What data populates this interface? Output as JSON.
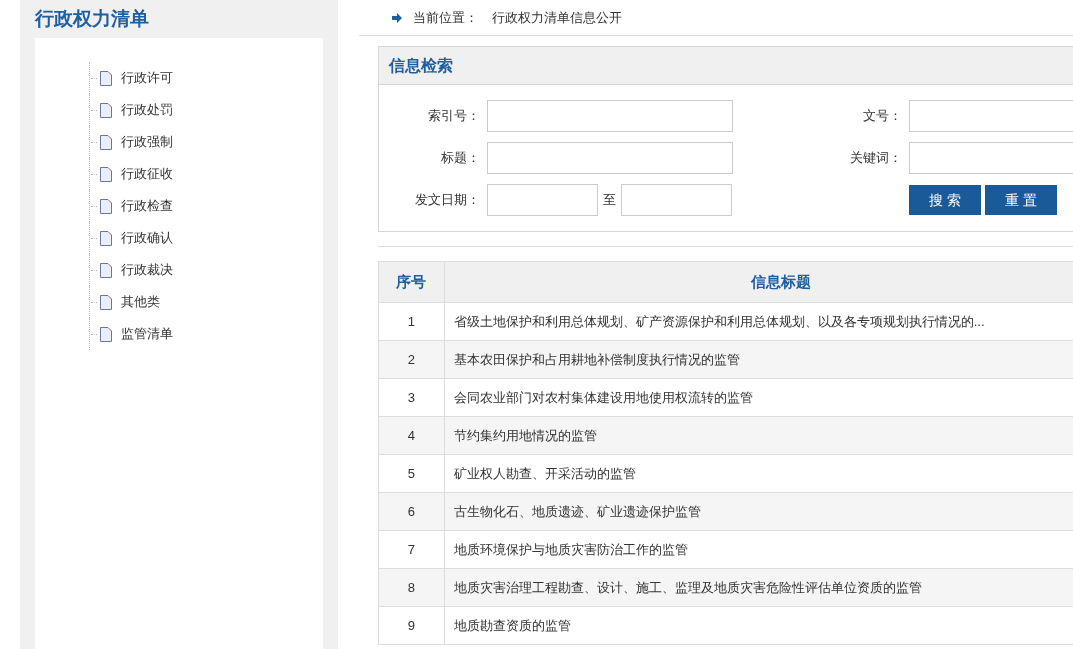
{
  "sidebar": {
    "title": "行政权力清单",
    "items": [
      {
        "label": "行政许可"
      },
      {
        "label": "行政处罚"
      },
      {
        "label": "行政强制"
      },
      {
        "label": "行政征收"
      },
      {
        "label": "行政检查"
      },
      {
        "label": "行政确认"
      },
      {
        "label": "行政裁决"
      },
      {
        "label": "其他类"
      },
      {
        "label": "监管清单"
      }
    ]
  },
  "breadcrumb": {
    "label": "当前位置：",
    "current": "行政权力清单信息公开"
  },
  "search": {
    "title": "信息检索",
    "fields": [
      {
        "label": "索引号："
      },
      {
        "label": "文号："
      },
      {
        "label": "标题："
      },
      {
        "label": "关键词："
      }
    ],
    "date_label": "发文日期：",
    "date_to": "至",
    "buttons": [
      "搜 索",
      "重 置"
    ]
  },
  "table": {
    "columns": [
      "序号",
      "信息标题"
    ],
    "rows": [
      [
        "1",
        "省级土地保护和利用总体规划、矿产资源保护和利用总体规划、以及各专项规划执行情况的..."
      ],
      [
        "2",
        "基本农田保护和占用耕地补偿制度执行情况的监管"
      ],
      [
        "3",
        "会同农业部门对农村集体建设用地使用权流转的监管"
      ],
      [
        "4",
        "节约集约用地情况的监管"
      ],
      [
        "5",
        "矿业权人勘查、开采活动的监管"
      ],
      [
        "6",
        "古生物化石、地质遗迹、矿业遗迹保护监管"
      ],
      [
        "7",
        "地质环境保护与地质灾害防治工作的监管"
      ],
      [
        "8",
        "地质灾害治理工程勘查、设计、施工、监理及地质灾害危险性评估单位资质的监管"
      ],
      [
        "9",
        "地质勘查资质的监管"
      ]
    ]
  }
}
